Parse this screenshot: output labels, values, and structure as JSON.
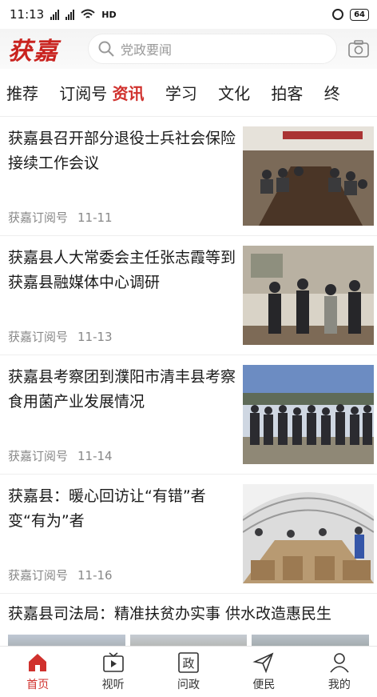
{
  "status": {
    "time": "11:13",
    "network": "HD",
    "battery": "64"
  },
  "header": {
    "logo": "获嘉",
    "search_placeholder": "党政要闻"
  },
  "tabs": [
    {
      "label": "推荐",
      "active": false
    },
    {
      "label": "订阅号",
      "active": false
    },
    {
      "label": "资讯",
      "active": true
    },
    {
      "label": "学习",
      "active": false
    },
    {
      "label": "文化",
      "active": false
    },
    {
      "label": "拍客",
      "active": false
    },
    {
      "label": "终",
      "active": false
    }
  ],
  "news": [
    {
      "title": "获嘉县召开部分退役士兵社会保险接续工作会议",
      "source": "获嘉订阅号",
      "date": "11-11",
      "image_icon": "meeting-photo"
    },
    {
      "title": "获嘉县人大常委会主任张志霞等到获嘉县融媒体中心调研",
      "source": "获嘉订阅号",
      "date": "11-13",
      "image_icon": "visit-photo"
    },
    {
      "title": "获嘉县考察团到濮阳市清丰县考察食用菌产业发展情况",
      "source": "获嘉订阅号",
      "date": "11-14",
      "image_icon": "group-photo"
    },
    {
      "title": "获嘉县：暖心回访让“有错”者变“有为”者",
      "source": "获嘉订阅号",
      "date": "11-16",
      "image_icon": "greenhouse-photo"
    }
  ],
  "wide_news": {
    "title": "获嘉县司法局：精准扶贫办实事 供水改造惠民生"
  },
  "bottom_nav": [
    {
      "label": "首页",
      "icon": "home-icon",
      "active": true
    },
    {
      "label": "视听",
      "icon": "tv-icon",
      "active": false
    },
    {
      "label": "问政",
      "icon": "politics-icon",
      "active": false
    },
    {
      "label": "便民",
      "icon": "send-icon",
      "active": false
    },
    {
      "label": "我的",
      "icon": "user-icon",
      "active": false
    }
  ],
  "colors": {
    "accent": "#d0312d",
    "logo": "#c9231f"
  }
}
